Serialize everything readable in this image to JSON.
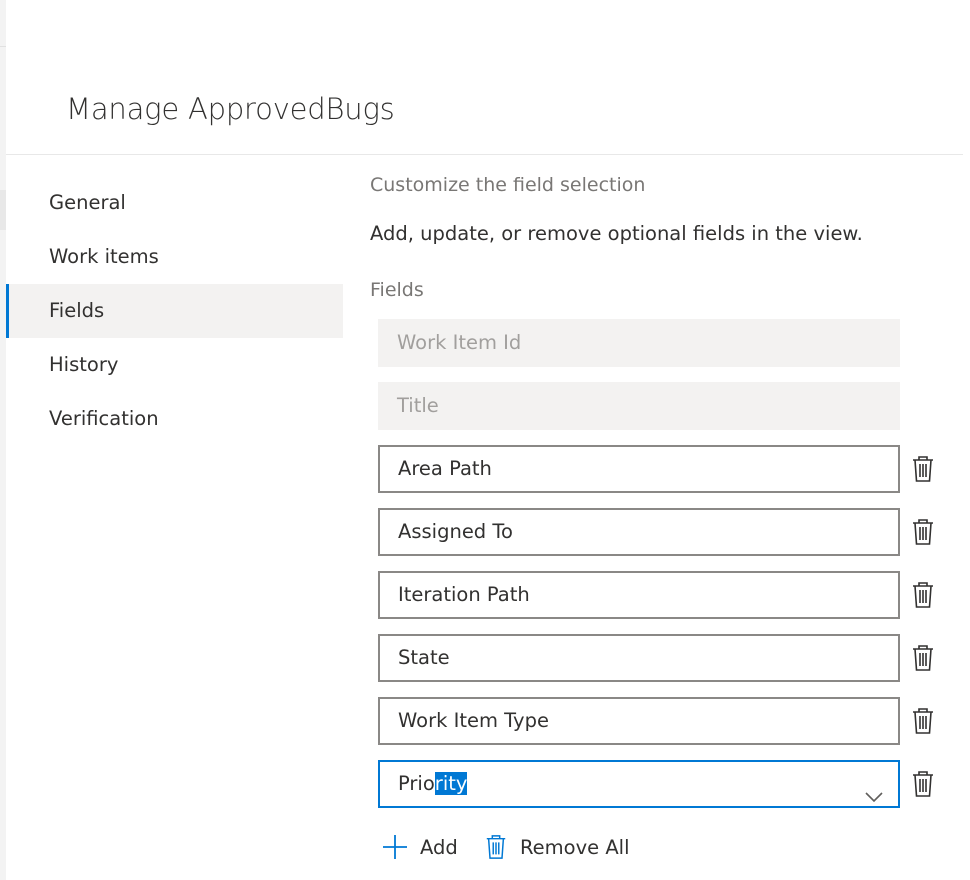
{
  "panel": {
    "title": "Manage ApprovedBugs"
  },
  "nav": {
    "items": [
      {
        "label": "General",
        "selected": false
      },
      {
        "label": "Work items",
        "selected": false
      },
      {
        "label": "Fields",
        "selected": true
      },
      {
        "label": "History",
        "selected": false
      },
      {
        "label": "Verification",
        "selected": false
      }
    ]
  },
  "content": {
    "section_title": "Customize the field selection",
    "description": "Add, update, or remove optional fields in the view.",
    "fields_label": "Fields",
    "fields": [
      {
        "name": "Work Item Id",
        "locked": true
      },
      {
        "name": "Title",
        "locked": true
      },
      {
        "name": "Area Path",
        "locked": false
      },
      {
        "name": "Assigned To",
        "locked": false
      },
      {
        "name": "Iteration Path",
        "locked": false
      },
      {
        "name": "State",
        "locked": false
      },
      {
        "name": "Work Item Type",
        "locked": false
      }
    ],
    "editing_field": {
      "typed": "Prio",
      "selected": "rity",
      "dropdown": "chevron-down-icon"
    },
    "add_label": "Add",
    "remove_all_label": "Remove All"
  },
  "colors": {
    "accent": "#0078d4",
    "disabled_bg": "#f3f2f1",
    "border": "#8a8886"
  }
}
